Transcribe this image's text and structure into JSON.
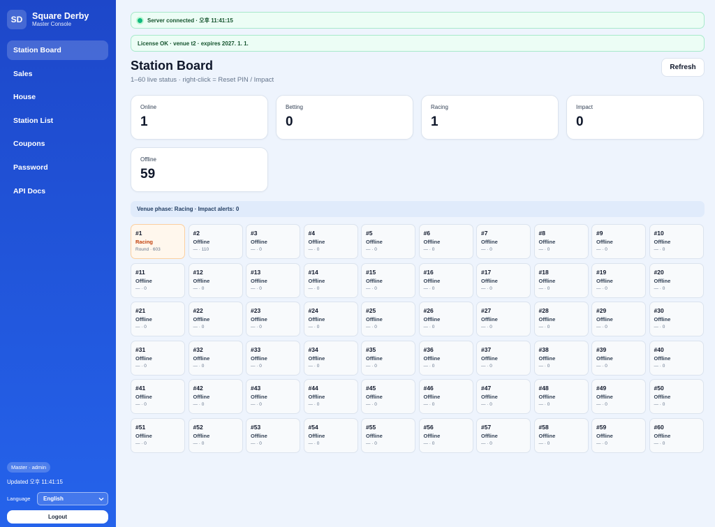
{
  "brand": {
    "logo": "SD",
    "title": "Square Derby",
    "subtitle": "Master Console"
  },
  "nav": [
    {
      "label": "Station Board",
      "active": true
    },
    {
      "label": "Sales"
    },
    {
      "label": "House"
    },
    {
      "label": "Station List"
    },
    {
      "label": "Coupons"
    },
    {
      "label": "Password"
    },
    {
      "label": "API Docs"
    }
  ],
  "footer": {
    "role": "Master · admin",
    "updated": "Updated 오후 11:41:15",
    "language_label": "Language",
    "language_value": "English",
    "logout": "Logout"
  },
  "banners": {
    "server": "Server connected · 오후 11:41:15",
    "license": "License OK · venue t2 · expires 2027. 1. 1."
  },
  "page": {
    "title": "Station Board",
    "subtitle": "1–60 live status · right-click = Reset PIN / Impact",
    "refresh": "Refresh"
  },
  "stats": [
    {
      "label": "Online",
      "value": "1"
    },
    {
      "label": "Betting",
      "value": "0"
    },
    {
      "label": "Racing",
      "value": "1"
    },
    {
      "label": "Impact",
      "value": "0"
    },
    {
      "label": "Offline",
      "value": "59"
    }
  ],
  "phase": "Venue phase: Racing · Impact alerts: 0",
  "stations": [
    {
      "num": "#1",
      "status": "Racing",
      "detail": "Round · 603",
      "state": "racing"
    },
    {
      "num": "#2",
      "status": "Offline",
      "detail": "— · 110"
    },
    {
      "num": "#3",
      "status": "Offline",
      "detail": "— · 0"
    },
    {
      "num": "#4",
      "status": "Offline",
      "detail": "— · 0"
    },
    {
      "num": "#5",
      "status": "Offline",
      "detail": "— · 0"
    },
    {
      "num": "#6",
      "status": "Offline",
      "detail": "— · 0"
    },
    {
      "num": "#7",
      "status": "Offline",
      "detail": "— · 0"
    },
    {
      "num": "#8",
      "status": "Offline",
      "detail": "— · 0"
    },
    {
      "num": "#9",
      "status": "Offline",
      "detail": "— · 0"
    },
    {
      "num": "#10",
      "status": "Offline",
      "detail": "— · 0"
    },
    {
      "num": "#11",
      "status": "Offline",
      "detail": "— · 0"
    },
    {
      "num": "#12",
      "status": "Offline",
      "detail": "— · 0"
    },
    {
      "num": "#13",
      "status": "Offline",
      "detail": "— · 0"
    },
    {
      "num": "#14",
      "status": "Offline",
      "detail": "— · 0"
    },
    {
      "num": "#15",
      "status": "Offline",
      "detail": "— · 0"
    },
    {
      "num": "#16",
      "status": "Offline",
      "detail": "— · 0"
    },
    {
      "num": "#17",
      "status": "Offline",
      "detail": "— · 0"
    },
    {
      "num": "#18",
      "status": "Offline",
      "detail": "— · 0"
    },
    {
      "num": "#19",
      "status": "Offline",
      "detail": "— · 0"
    },
    {
      "num": "#20",
      "status": "Offline",
      "detail": "— · 0"
    },
    {
      "num": "#21",
      "status": "Offline",
      "detail": "— · 0"
    },
    {
      "num": "#22",
      "status": "Offline",
      "detail": "— · 0"
    },
    {
      "num": "#23",
      "status": "Offline",
      "detail": "— · 0"
    },
    {
      "num": "#24",
      "status": "Offline",
      "detail": "— · 0"
    },
    {
      "num": "#25",
      "status": "Offline",
      "detail": "— · 0"
    },
    {
      "num": "#26",
      "status": "Offline",
      "detail": "— · 0"
    },
    {
      "num": "#27",
      "status": "Offline",
      "detail": "— · 0"
    },
    {
      "num": "#28",
      "status": "Offline",
      "detail": "— · 0"
    },
    {
      "num": "#29",
      "status": "Offline",
      "detail": "— · 0"
    },
    {
      "num": "#30",
      "status": "Offline",
      "detail": "— · 0"
    },
    {
      "num": "#31",
      "status": "Offline",
      "detail": "— · 0"
    },
    {
      "num": "#32",
      "status": "Offline",
      "detail": "— · 0"
    },
    {
      "num": "#33",
      "status": "Offline",
      "detail": "— · 0"
    },
    {
      "num": "#34",
      "status": "Offline",
      "detail": "— · 0"
    },
    {
      "num": "#35",
      "status": "Offline",
      "detail": "— · 0"
    },
    {
      "num": "#36",
      "status": "Offline",
      "detail": "— · 0"
    },
    {
      "num": "#37",
      "status": "Offline",
      "detail": "— · 0"
    },
    {
      "num": "#38",
      "status": "Offline",
      "detail": "— · 0"
    },
    {
      "num": "#39",
      "status": "Offline",
      "detail": "— · 0"
    },
    {
      "num": "#40",
      "status": "Offline",
      "detail": "— · 0"
    },
    {
      "num": "#41",
      "status": "Offline",
      "detail": "— · 0"
    },
    {
      "num": "#42",
      "status": "Offline",
      "detail": "— · 0"
    },
    {
      "num": "#43",
      "status": "Offline",
      "detail": "— · 0"
    },
    {
      "num": "#44",
      "status": "Offline",
      "detail": "— · 0"
    },
    {
      "num": "#45",
      "status": "Offline",
      "detail": "— · 0"
    },
    {
      "num": "#46",
      "status": "Offline",
      "detail": "— · 0"
    },
    {
      "num": "#47",
      "status": "Offline",
      "detail": "— · 0"
    },
    {
      "num": "#48",
      "status": "Offline",
      "detail": "— · 0"
    },
    {
      "num": "#49",
      "status": "Offline",
      "detail": "— · 0"
    },
    {
      "num": "#50",
      "status": "Offline",
      "detail": "— · 0"
    },
    {
      "num": "#51",
      "status": "Offline",
      "detail": "— · 0"
    },
    {
      "num": "#52",
      "status": "Offline",
      "detail": "— · 0"
    },
    {
      "num": "#53",
      "status": "Offline",
      "detail": "— · 0"
    },
    {
      "num": "#54",
      "status": "Offline",
      "detail": "— · 0"
    },
    {
      "num": "#55",
      "status": "Offline",
      "detail": "— · 0"
    },
    {
      "num": "#56",
      "status": "Offline",
      "detail": "— · 0"
    },
    {
      "num": "#57",
      "status": "Offline",
      "detail": "— · 0"
    },
    {
      "num": "#58",
      "status": "Offline",
      "detail": "— · 0"
    },
    {
      "num": "#59",
      "status": "Offline",
      "detail": "— · 0"
    },
    {
      "num": "#60",
      "status": "Offline",
      "detail": "— · 0"
    }
  ]
}
